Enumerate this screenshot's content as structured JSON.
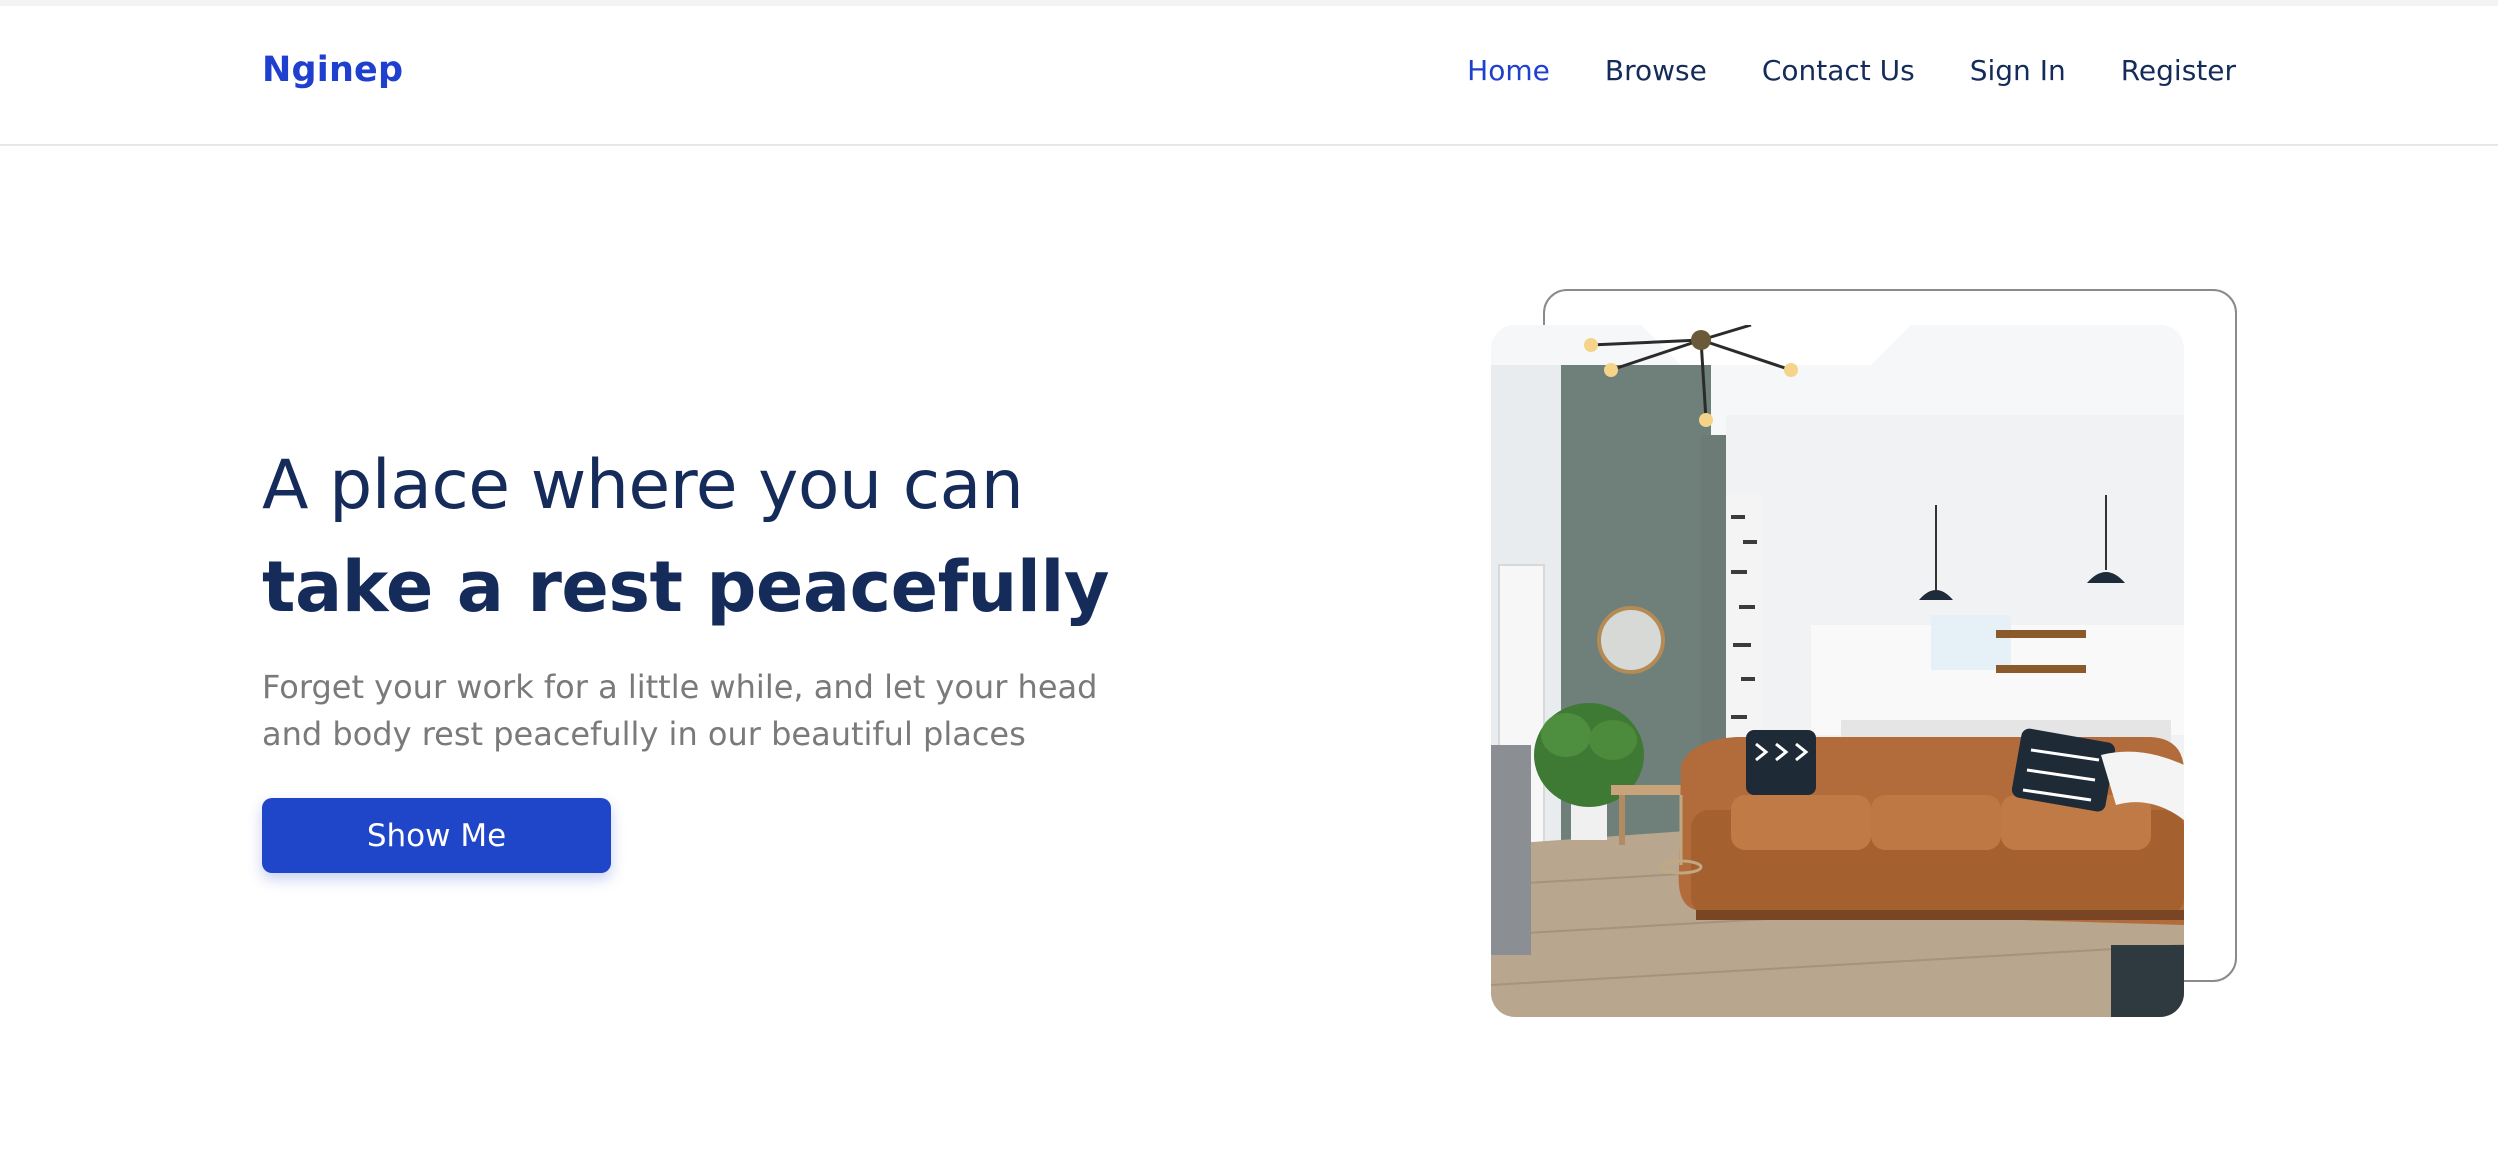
{
  "header": {
    "logo": "Nginep",
    "nav": [
      {
        "label": "Home",
        "active": true
      },
      {
        "label": "Browse",
        "active": false
      },
      {
        "label": "Contact Us",
        "active": false
      },
      {
        "label": "Sign In",
        "active": false
      },
      {
        "label": "Register",
        "active": false
      }
    ]
  },
  "hero": {
    "title_line1": "A place where you can",
    "title_line2": "take a rest peacefully",
    "subtitle": "Forget your work for a little while, and let your head and body rest peacefully in our beautiful places",
    "cta_label": "Show Me"
  },
  "colors": {
    "brand": "#1f3fcf",
    "primary_text": "#152c5b",
    "muted_text": "#7a7a7a",
    "button": "#1f45c9"
  },
  "image": {
    "subject": "living-room-photo"
  }
}
